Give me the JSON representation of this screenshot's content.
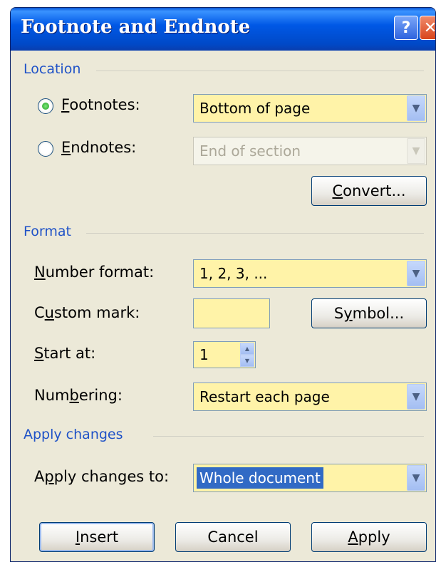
{
  "dialog": {
    "title": "Footnote and Endnote",
    "help_glyph": "?",
    "close_glyph": "✕"
  },
  "location": {
    "header": "Location",
    "footnotes": {
      "label_mnemonic": "F",
      "label_rest": "ootnotes:",
      "selected": true,
      "value": "Bottom of page"
    },
    "endnotes": {
      "label_mnemonic": "E",
      "label_rest": "ndnotes:",
      "selected": false,
      "value": "End of section"
    },
    "convert_mnemonic": "C",
    "convert_rest": "onvert..."
  },
  "format": {
    "header": "Format",
    "number_format": {
      "label_mnemonic": "N",
      "label_rest": "umber format:",
      "value": "1, 2, 3, ..."
    },
    "custom_mark": {
      "label_pre": "C",
      "label_mnemonic": "u",
      "label_rest": "stom mark:",
      "value": ""
    },
    "symbol_pre": "S",
    "symbol_mnemonic": "y",
    "symbol_rest": "mbol...",
    "start_at": {
      "label_mnemonic": "S",
      "label_rest": "tart at:",
      "value": "1"
    },
    "numbering": {
      "label_pre": "Num",
      "label_mnemonic": "b",
      "label_rest": "ering:",
      "value": "Restart each page"
    }
  },
  "apply_changes": {
    "header": "Apply changes",
    "label_pre": "A",
    "label_mnemonic": "p",
    "label_rest": "ply changes to:",
    "value": "Whole document"
  },
  "buttons": {
    "insert_mnemonic": "I",
    "insert_rest": "nsert",
    "cancel": "Cancel",
    "apply_mnemonic": "A",
    "apply_rest": "pply"
  },
  "colors": {
    "dialog_bg": "#ECE9D8",
    "group_header": "#1F52C7",
    "field_bg": "#FFF3A8",
    "selection": "#316AC5",
    "titlebar": "#0058E6"
  }
}
